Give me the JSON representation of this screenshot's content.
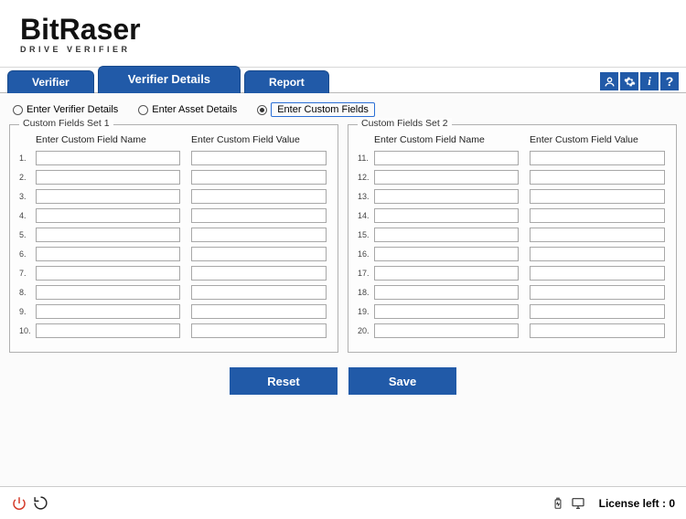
{
  "app": {
    "logo_main": "BitRaser",
    "logo_sub": "DRIVE VERIFIER"
  },
  "tabs": {
    "t0": "Verifier",
    "t1": "Verifier Details",
    "t2": "Report",
    "active_index": 1
  },
  "toolbar_icons": {
    "user": "user-icon",
    "settings": "gear-icon",
    "info": "info-icon",
    "help": "help-icon"
  },
  "radios": {
    "r0": "Enter Verifier Details",
    "r1": "Enter Asset Details",
    "r2": "Enter Custom Fields",
    "selected_index": 2
  },
  "set1": {
    "legend": "Custom Fields Set 1",
    "head_name": "Enter Custom Field Name",
    "head_value": "Enter Custom Field Value",
    "nums": [
      "1.",
      "2.",
      "3.",
      "4.",
      "5.",
      "6.",
      "7.",
      "8.",
      "9.",
      "10."
    ]
  },
  "set2": {
    "legend": "Custom Fields Set  2",
    "head_name": "Enter Custom Field Name",
    "head_value": "Enter Custom Field Value",
    "nums": [
      "11.",
      "12.",
      "13.",
      "14.",
      "15.",
      "16.",
      "17.",
      "18.",
      "19.",
      "20."
    ]
  },
  "buttons": {
    "reset": "Reset",
    "save": "Save"
  },
  "footer": {
    "license_label": "License left :  0"
  }
}
